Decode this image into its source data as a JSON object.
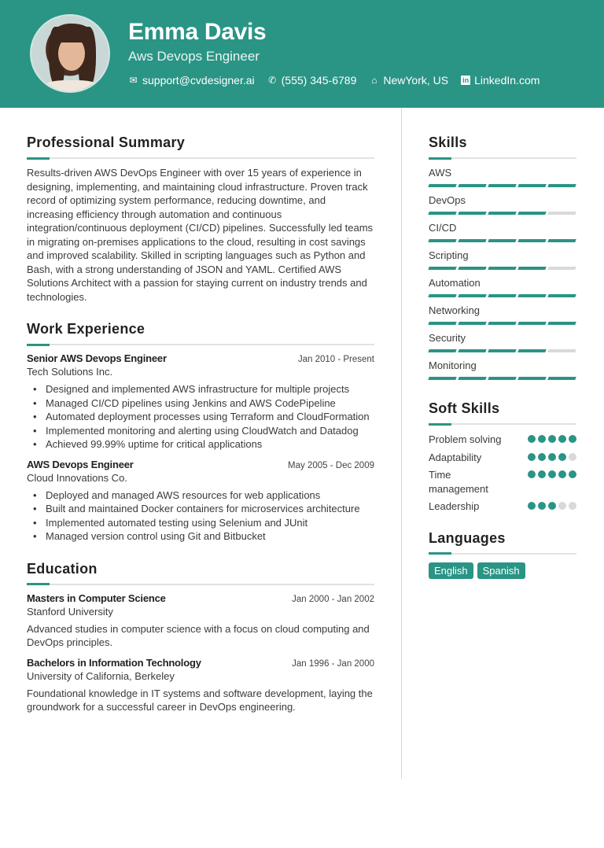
{
  "header": {
    "name": "Emma Davis",
    "role": "Aws Devops Engineer",
    "contacts": [
      {
        "icon": "mail-icon",
        "text": "support@cvdesigner.ai"
      },
      {
        "icon": "phone-icon",
        "text": "(555) 345-6789"
      },
      {
        "icon": "home-icon",
        "text": "NewYork, US"
      },
      {
        "icon": "linkedin-icon",
        "text": "LinkedIn.com"
      }
    ]
  },
  "summary": {
    "title": "Professional Summary",
    "text": "Results-driven AWS DevOps Engineer with over 15 years of experience in designing, implementing, and maintaining cloud infrastructure. Proven track record of optimizing system performance, reducing downtime, and increasing efficiency through automation and continuous integration/continuous deployment (CI/CD) pipelines. Successfully led teams in migrating on-premises applications to the cloud, resulting in cost savings and improved scalability. Skilled in scripting languages such as Python and Bash, with a strong understanding of JSON and YAML. Certified AWS Solutions Architect with a passion for staying current on industry trends and technologies."
  },
  "experience": {
    "title": "Work Experience",
    "jobs": [
      {
        "title": "Senior AWS Devops Engineer",
        "date": "Jan 2010 - Present",
        "org": "Tech Solutions Inc.",
        "bullets": [
          "Designed and implemented AWS infrastructure for multiple projects",
          "Managed CI/CD pipelines using Jenkins and AWS CodePipeline",
          "Automated deployment processes using Terraform and CloudFormation",
          "Implemented monitoring and alerting using CloudWatch and Datadog",
          "Achieved 99.99% uptime for critical applications"
        ]
      },
      {
        "title": "AWS Devops Engineer",
        "date": "May 2005 - Dec 2009",
        "org": "Cloud Innovations Co.",
        "bullets": [
          "Deployed and managed AWS resources for web applications",
          "Built and maintained Docker containers for microservices architecture",
          "Implemented automated testing using Selenium and JUnit",
          "Managed version control using Git and Bitbucket"
        ]
      }
    ]
  },
  "education": {
    "title": "Education",
    "items": [
      {
        "degree": "Masters in Computer Science",
        "date": "Jan 2000 - Jan 2002",
        "school": "Stanford University",
        "desc": "Advanced studies in computer science with a focus on cloud computing and DevOps principles."
      },
      {
        "degree": "Bachelors in Information Technology",
        "date": "Jan 1996 - Jan 2000",
        "school": "University of California, Berkeley",
        "desc": "Foundational knowledge in IT systems and software development, laying the groundwork for a successful career in DevOps engineering."
      }
    ]
  },
  "skills": {
    "title": "Skills",
    "max": 5,
    "items": [
      {
        "name": "AWS",
        "level": 5
      },
      {
        "name": "DevOps",
        "level": 4
      },
      {
        "name": "CI/CD",
        "level": 5
      },
      {
        "name": "Scripting",
        "level": 4
      },
      {
        "name": "Automation",
        "level": 5
      },
      {
        "name": "Networking",
        "level": 5
      },
      {
        "name": "Security",
        "level": 4
      },
      {
        "name": "Monitoring",
        "level": 5
      }
    ]
  },
  "soft_skills": {
    "title": "Soft Skills",
    "max": 5,
    "items": [
      {
        "name": "Problem solving",
        "level": 5
      },
      {
        "name": "Adaptability",
        "level": 4
      },
      {
        "name": "Time management",
        "level": 5
      },
      {
        "name": "Leadership",
        "level": 3
      }
    ]
  },
  "languages": {
    "title": "Languages",
    "items": [
      "English",
      "Spanish"
    ]
  },
  "colors": {
    "accent": "#2a9485",
    "inactive": "#d9d9d9"
  }
}
